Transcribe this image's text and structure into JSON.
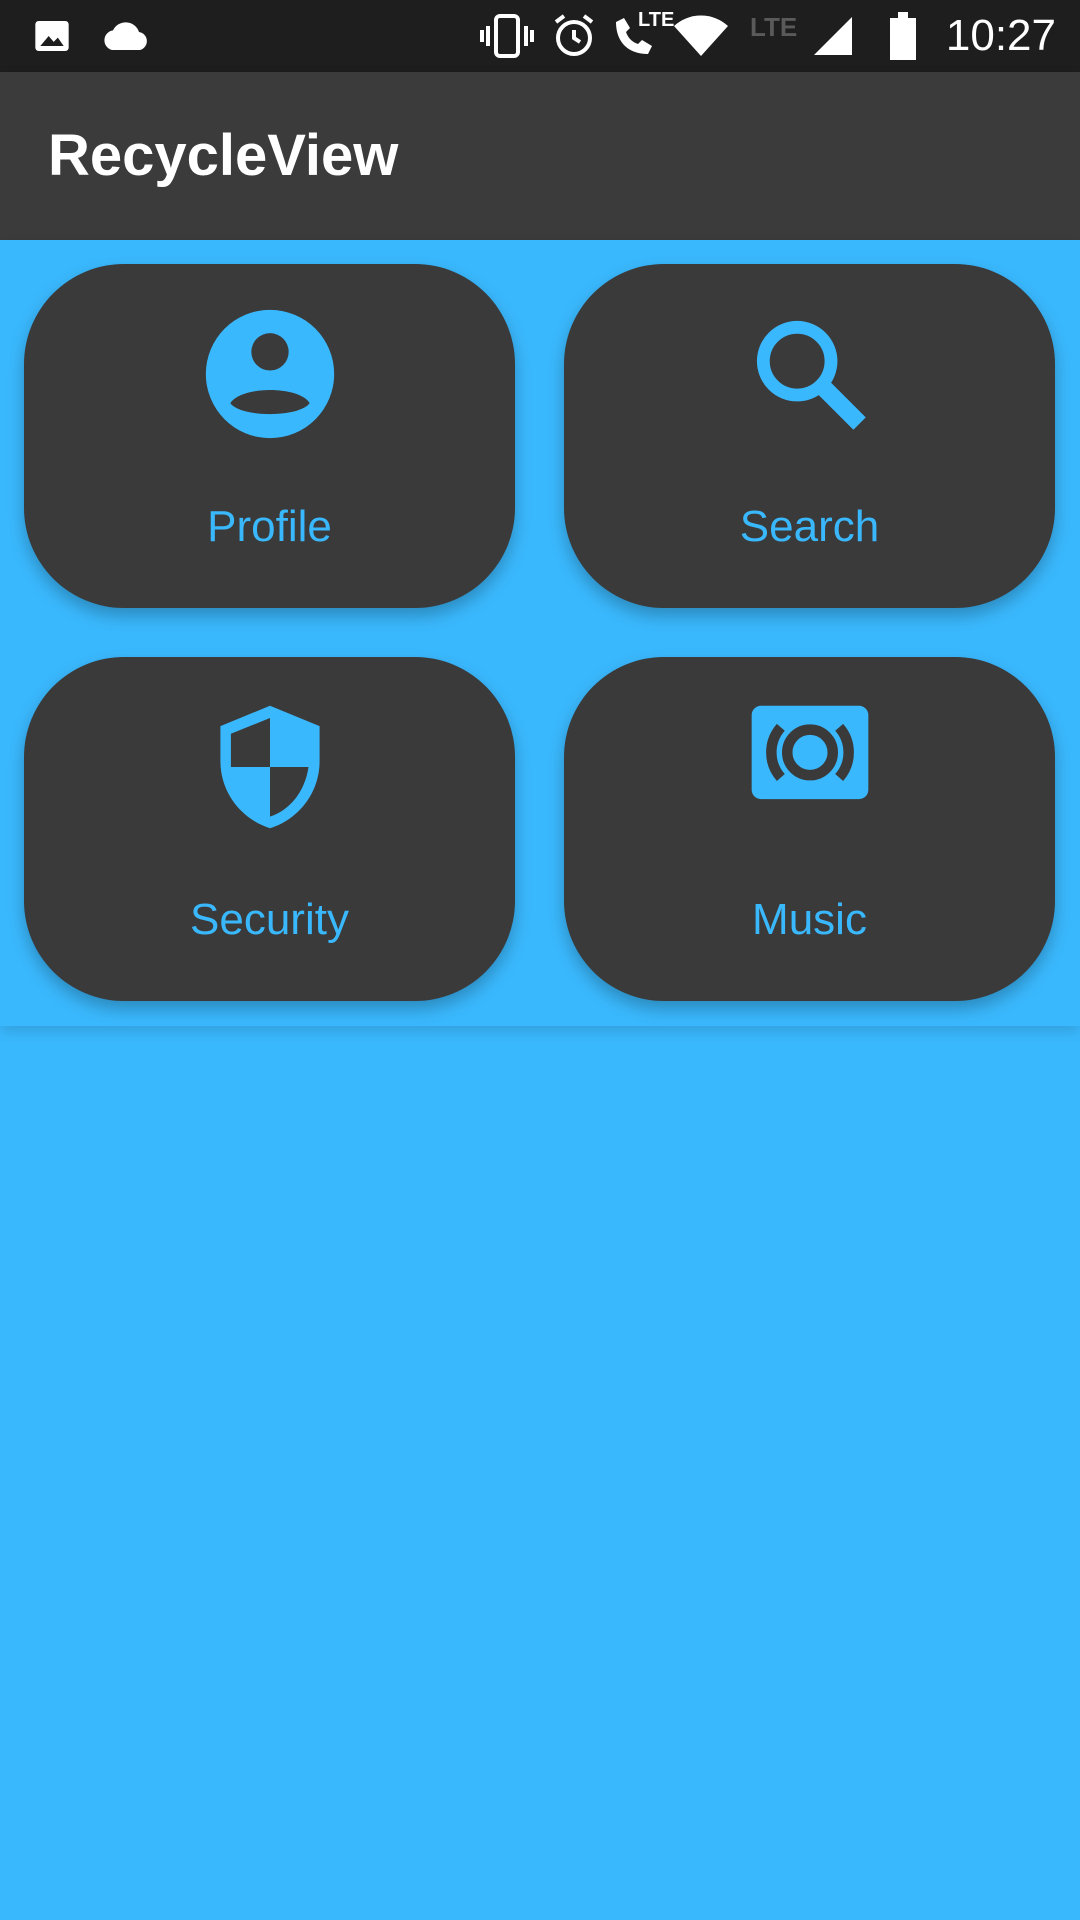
{
  "status_bar": {
    "time": "10:27",
    "left_icons": [
      "image-icon",
      "cloud-icon"
    ],
    "right_icons": [
      "vibrate-icon",
      "alarm-icon",
      "lte-call-icon",
      "wifi-icon",
      "lte-icon",
      "signal-icon",
      "battery-icon"
    ],
    "lte_call_label": "LTE",
    "lte_label": "LTE"
  },
  "app_bar": {
    "title": "RecycleView"
  },
  "tiles": [
    {
      "label": "Profile",
      "icon": "account-circle-icon"
    },
    {
      "label": "Search",
      "icon": "search-icon"
    },
    {
      "label": "Security",
      "icon": "security-shield-icon"
    },
    {
      "label": "Music",
      "icon": "speaker-icon"
    }
  ],
  "colors": {
    "accent": "#3AB8FD",
    "tile_background": "#3A3A3A",
    "app_bar": "#3B3B3B",
    "status_bar": "#1E1E1E"
  }
}
